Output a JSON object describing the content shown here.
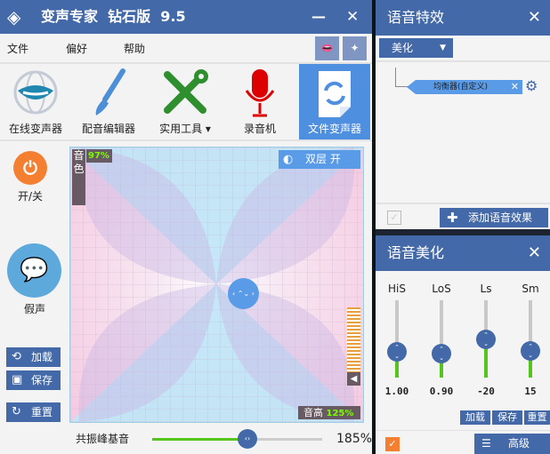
{
  "app": {
    "title": "变声专家  钻石版  9.5",
    "minimize": "—",
    "close": "✕"
  },
  "menu": [
    "文件",
    "偏好",
    "帮助"
  ],
  "toolbar": [
    {
      "label": "在线变声器",
      "icon": "lips-globe-icon"
    },
    {
      "label": "配音编辑器",
      "icon": "paintbrush-icon"
    },
    {
      "label": "实用工具",
      "icon": "tools-icon"
    },
    {
      "label": "录音机",
      "icon": "microphone-icon"
    },
    {
      "label": "文件变声器",
      "icon": "file-refresh-icon"
    }
  ],
  "side": {
    "power_label": "开/关",
    "falsetto_label": "假声",
    "load": "加载",
    "save": "保存",
    "reset": "重置"
  },
  "pad": {
    "timbre_label": "音色",
    "timbre_value": "97%",
    "pitch_label": "音高",
    "pitch_value": "125%",
    "dual_layer": "双层  开"
  },
  "resonance": {
    "label": "共振峰基音",
    "value": "185%",
    "fraction": 0.56
  },
  "effects": {
    "title": "语音特效",
    "category": "美化",
    "chain_item": "均衡器(自定义)",
    "add_button": "添加语音效果"
  },
  "beautify": {
    "title": "语音美化",
    "sliders": [
      {
        "name": "HiS",
        "value": "1.00",
        "level": 0.33
      },
      {
        "name": "LoS",
        "value": "0.90",
        "level": 0.31
      },
      {
        "name": "Ls",
        "value": "-20",
        "level": 0.5
      },
      {
        "name": "Sm",
        "value": "15",
        "level": 0.35
      }
    ],
    "load": "加载",
    "save": "保存",
    "reset": "重置",
    "advanced": "高级"
  },
  "colors": {
    "accent": "#4369a8",
    "green": "#55c41c",
    "orange": "#f57f30"
  }
}
